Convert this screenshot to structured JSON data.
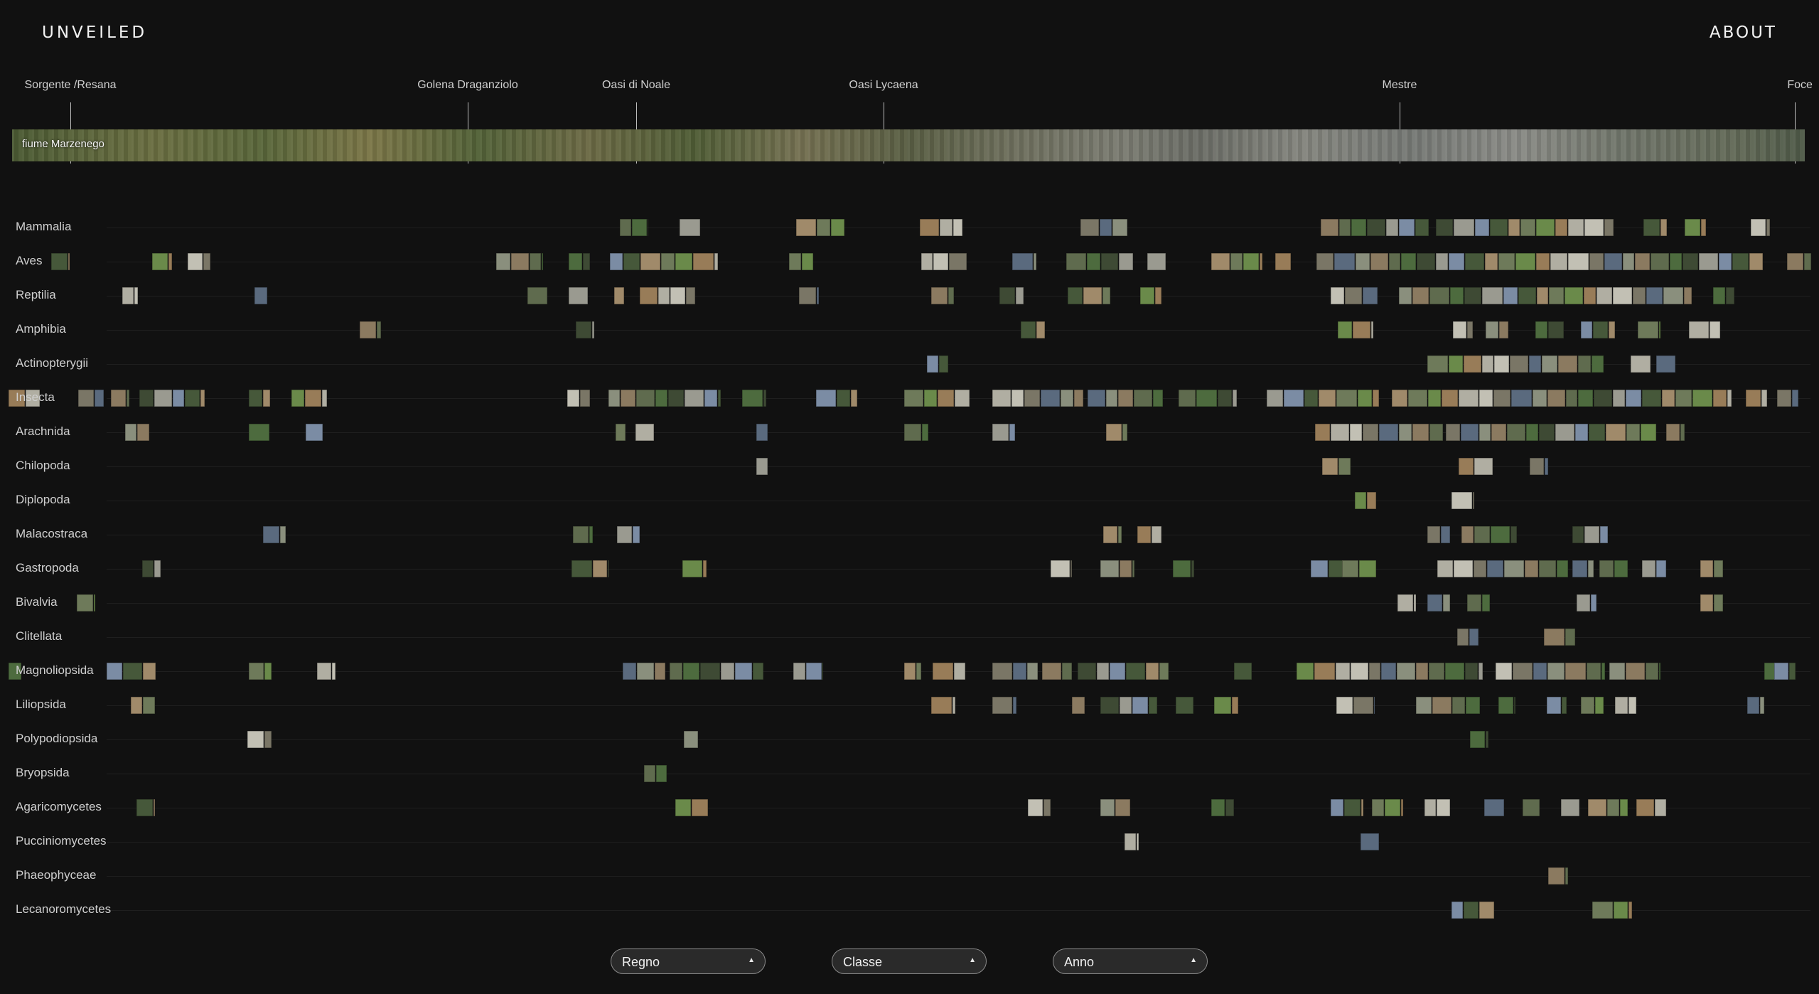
{
  "header": {
    "brand": "UNVEILED",
    "about": "ABOUT"
  },
  "river": {
    "name": "fiume Marzenego",
    "landmarks": [
      "Sorgente /Resana",
      "Golena Draganziolo",
      "Oasi di Noale",
      "Oasi Lycaena",
      "Mestre",
      "Foce"
    ]
  },
  "classes": [
    "Mammalia",
    "Aves",
    "Reptilia",
    "Amphibia",
    "Actinopterygii",
    "Insecta",
    "Arachnida",
    "Chilopoda",
    "Diplopoda",
    "Malacostraca",
    "Gastropoda",
    "Bivalvia",
    "Clitellata",
    "Magnoliopsida",
    "Liliopsida",
    "Polypodiopsida",
    "Bryopsida",
    "Agaricomycetes",
    "Pucciniomycetes",
    "Phaeophyceae",
    "Lecanoromycetes"
  ],
  "filters": [
    {
      "label": "Regno",
      "arrow": "▲"
    },
    {
      "label": "Classe",
      "arrow": "▲"
    },
    {
      "label": "Anno",
      "arrow": "▲"
    }
  ]
}
